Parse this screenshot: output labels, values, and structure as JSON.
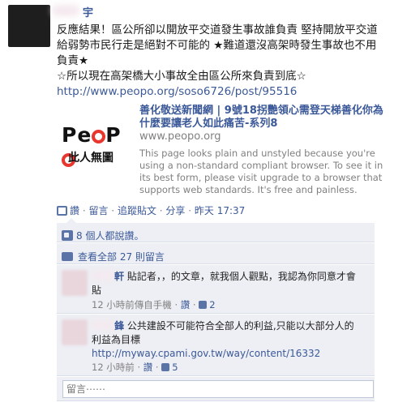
{
  "post": {
    "poster_name": "宇",
    "text_line1": "反應結果！區公所卻以開放平交道發生事故誰負責 堅持開放平交道",
    "text_line2": "給弱勢市民行走是絕對不可能的 ★難道還沒高架時發生事故也不用",
    "text_line3": "負責★",
    "text_line4": "☆所以現在高架橋大小事故全由區公所來負責到底☆",
    "link": "http://www.peopo.org/soso6726/post/95516"
  },
  "attachment": {
    "logo_text": "PeoPo",
    "logo_subtitle": "此人無圖",
    "title": "善化敬送新聞網 | 9號18拐艷領心需登天梯善化你為什麼要讓老人如此痛苦-系列8",
    "domain": "www.peopo.org",
    "description": "This page looks plain and unstyled because you're using a non-standard compliant browser. To see it in its best form, please visit upgrade to a browser that supports web standards. It's free and painless."
  },
  "actions": {
    "like": "讚",
    "comment": "留言",
    "unlike": "追蹤貼文",
    "share": "分享",
    "separator": " · ",
    "timestamp": "昨天 17:37"
  },
  "feedback": {
    "likes_text": "8 個人都說讚。",
    "view_all": "查看全部 27 則留言"
  },
  "comments": [
    {
      "name": "軒",
      "text_line1": "貼記者，，的文章，就我個人觀點，我認為你同意才會",
      "text_line2": "貼",
      "time": "12 小時前",
      "via": "傳自手機",
      "like": "讚",
      "likes": "2"
    },
    {
      "name": "鋒",
      "text_line1": "公共建設不可能符合全部人的利益,只能以大部分人的",
      "text_line2": "利益為目標",
      "link": "http://myway.cpami.gov.tw/way/content/16332",
      "time": "12 小時前",
      "like": "讚",
      "likes": "5"
    }
  ],
  "comment_input": {
    "placeholder": "留言⋯⋯"
  }
}
